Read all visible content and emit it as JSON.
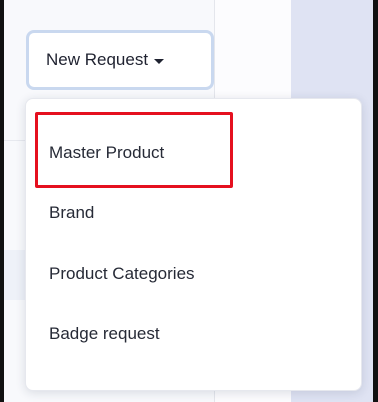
{
  "new_request_button": {
    "label": "New Request",
    "icon": "caret-down-icon"
  },
  "dropdown": {
    "items": [
      {
        "label": "Master Product",
        "highlighted": true
      },
      {
        "label": "Brand"
      },
      {
        "label": "Product Categories"
      },
      {
        "label": "Badge request"
      }
    ]
  },
  "colors": {
    "highlight_border": "#e5101f",
    "button_border": "#c9d8ef",
    "right_panel": "#dfe3f3"
  }
}
